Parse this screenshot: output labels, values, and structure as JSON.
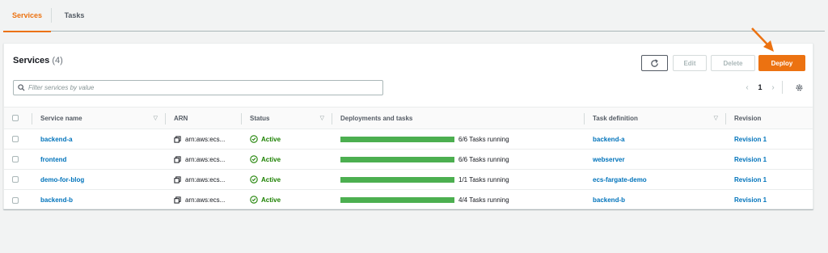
{
  "tabs": [
    {
      "label": "Services",
      "active": true
    },
    {
      "label": "Tasks",
      "active": false
    }
  ],
  "panel": {
    "title": "Services",
    "count": "(4)"
  },
  "toolbar": {
    "edit_label": "Edit",
    "delete_label": "Delete",
    "deploy_label": "Deploy",
    "refresh_icon": "refresh-icon"
  },
  "search": {
    "placeholder": "Filter services by value",
    "value": ""
  },
  "pagination": {
    "current_page": "1"
  },
  "table": {
    "columns": [
      "Service name",
      "ARN",
      "Status",
      "Deployments and tasks",
      "Task definition",
      "Revision"
    ],
    "rows": [
      {
        "service_name": "backend-a",
        "arn": "arn:aws:ecs...",
        "status": "Active",
        "tasks_text": "6/6 Tasks running",
        "running": 6,
        "desired": 6,
        "task_definition": "backend-a",
        "revision": "Revision 1"
      },
      {
        "service_name": "frontend",
        "arn": "arn:aws:ecs...",
        "status": "Active",
        "tasks_text": "6/6 Tasks running",
        "running": 6,
        "desired": 6,
        "task_definition": "webserver",
        "revision": "Revision 1"
      },
      {
        "service_name": "demo-for-blog",
        "arn": "arn:aws:ecs...",
        "status": "Active",
        "tasks_text": "1/1 Tasks running",
        "running": 1,
        "desired": 1,
        "task_definition": "ecs-fargate-demo",
        "revision": "Revision 1"
      },
      {
        "service_name": "backend-b",
        "arn": "arn:aws:ecs...",
        "status": "Active",
        "tasks_text": "4/4 Tasks running",
        "running": 4,
        "desired": 4,
        "task_definition": "backend-b",
        "revision": "Revision 1"
      }
    ]
  },
  "colors": {
    "accent": "#ec7211",
    "link": "#0073bb",
    "success": "#1d8102",
    "progress": "#4caf50"
  }
}
